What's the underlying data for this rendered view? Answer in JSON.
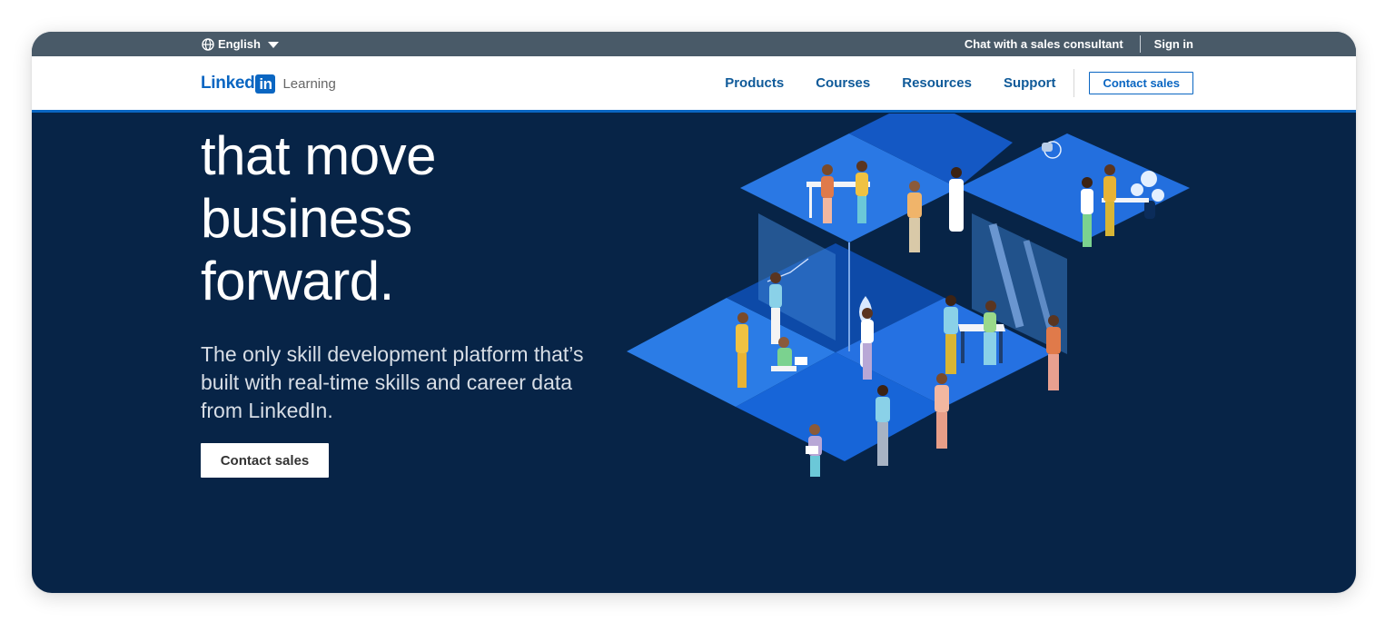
{
  "topbar": {
    "language": "English",
    "chat_link": "Chat with a sales consultant",
    "sign_in": "Sign in"
  },
  "navbar": {
    "logo_word": "Linked",
    "logo_in": "in",
    "logo_product": "Learning",
    "links": [
      "Products",
      "Courses",
      "Resources",
      "Support"
    ],
    "cta": "Contact sales"
  },
  "hero": {
    "title_lines": [
      "that move",
      "business",
      "forward."
    ],
    "subtitle": "The only skill development platform that’s built with real-time skills and career data from LinkedIn.",
    "cta": "Contact sales"
  },
  "colors": {
    "topbar_bg": "#495a68",
    "hero_bg": "#072447",
    "brand_blue": "#0a66c2",
    "nav_link": "#0f5a99"
  },
  "icons": {
    "language": "globe-icon",
    "language_dropdown": "caret-down-icon"
  }
}
